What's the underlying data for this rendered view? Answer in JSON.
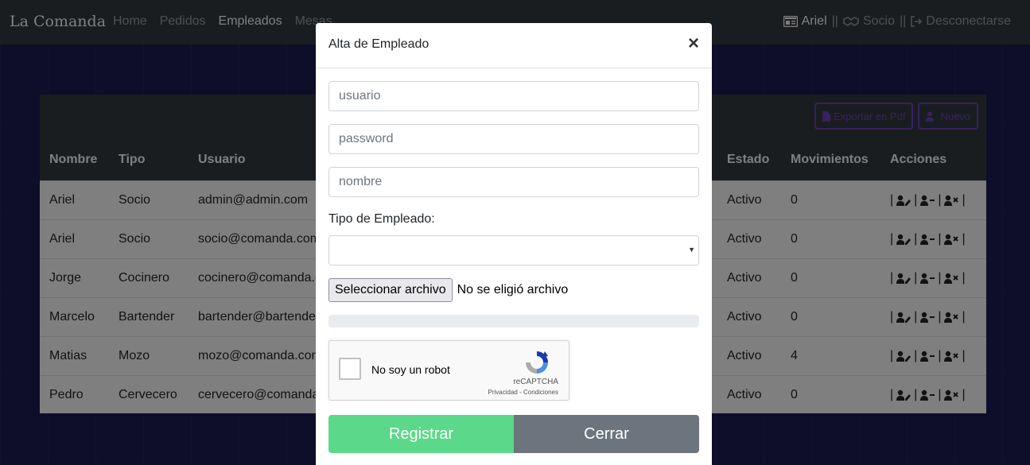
{
  "navbar": {
    "brand": "La Comanda",
    "links": [
      "Home",
      "Pedidos",
      "Empleados",
      "Mesas"
    ],
    "active_link": "Empleados",
    "user_name": "Ariel",
    "separator": "||",
    "role": "Socio",
    "logout": "Desconectarse"
  },
  "card": {
    "export_label": "Exportar en Pdf",
    "new_label": "Nuevo"
  },
  "table": {
    "headers": [
      "Nombre",
      "Tipo",
      "Usuario",
      "Estado",
      "Movimientos",
      "Acciones"
    ],
    "rows": [
      {
        "nombre": "Ariel",
        "tipo": "Socio",
        "usuario": "admin@admin.com",
        "estado": "Activo",
        "movimientos": "0"
      },
      {
        "nombre": "Ariel",
        "tipo": "Socio",
        "usuario": "socio@comanda.com",
        "estado": "Activo",
        "movimientos": "0"
      },
      {
        "nombre": "Jorge",
        "tipo": "Cocinero",
        "usuario": "cocinero@comanda.com",
        "estado": "Activo",
        "movimientos": "0"
      },
      {
        "nombre": "Marcelo",
        "tipo": "Bartender",
        "usuario": "bartender@bartender.com",
        "estado": "Activo",
        "movimientos": "0"
      },
      {
        "nombre": "Matias",
        "tipo": "Mozo",
        "usuario": "mozo@comanda.com",
        "estado": "Activo",
        "movimientos": "4"
      },
      {
        "nombre": "Pedro",
        "tipo": "Cervecero",
        "usuario": "cervecero@comanda.com",
        "estado": "Activo",
        "movimientos": "0"
      }
    ],
    "action_separator": "|"
  },
  "modal": {
    "title": "Alta de Empleado",
    "close": "×",
    "usuario_placeholder": "usuario",
    "password_placeholder": "password",
    "nombre_placeholder": "nombre",
    "tipo_label": "Tipo de Empleado:",
    "tipo_selected": "",
    "file_button": "Seleccionar archivo",
    "file_status": "No se eligió archivo",
    "progress": 0,
    "captcha_label": "No soy un robot",
    "captcha_brand": "reCAPTCHA",
    "captcha_links": "Privacidad - Condiciones",
    "registrar": "Registrar",
    "cerrar": "Cerrar"
  },
  "colors": {
    "navbar": "#343a40",
    "success": "#5cd88a",
    "secondary": "#6c757d",
    "accent": "#6f42c1"
  }
}
